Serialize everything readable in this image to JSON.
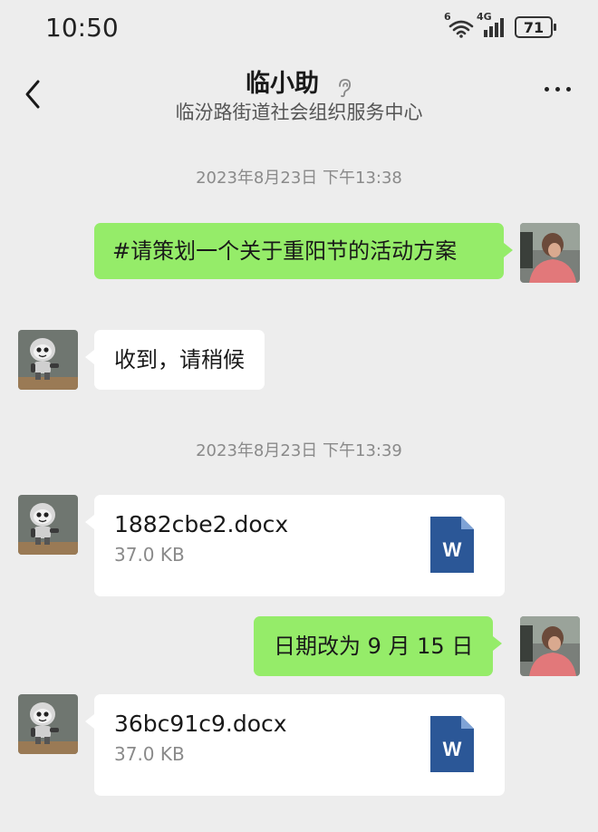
{
  "status_bar": {
    "time": "10:50",
    "wifi_label": "6",
    "network_label": "4G",
    "battery": "71"
  },
  "header": {
    "title": "临小助",
    "subtitle": "临汾路街道社会组织服务中心"
  },
  "messages": [
    {
      "type": "timestamp",
      "text": "2023年8月23日 下午13:38"
    },
    {
      "type": "text",
      "sender": "me",
      "text": "#请策划一个关于重阳节的活动方案"
    },
    {
      "type": "text",
      "sender": "bot",
      "text": "收到，请稍候"
    },
    {
      "type": "timestamp",
      "text": "2023年8月23日 下午13:39"
    },
    {
      "type": "file",
      "sender": "bot",
      "file_name": "1882cbe2.docx",
      "file_size": "37.0 KB",
      "icon_letter": "W"
    },
    {
      "type": "text",
      "sender": "me",
      "text": "日期改为 9 月 15 日"
    },
    {
      "type": "file",
      "sender": "bot",
      "file_name": "36bc91c9.docx",
      "file_size": "37.0 KB",
      "icon_letter": "W"
    }
  ],
  "icons": {
    "back": "chevron-left-icon",
    "ear": "ear-icon",
    "more": "more-icon",
    "doc": "word-doc-icon"
  },
  "colors": {
    "background": "#ededed",
    "my_bubble": "#95ec69",
    "other_bubble": "#ffffff",
    "word_blue": "#2b5797"
  }
}
